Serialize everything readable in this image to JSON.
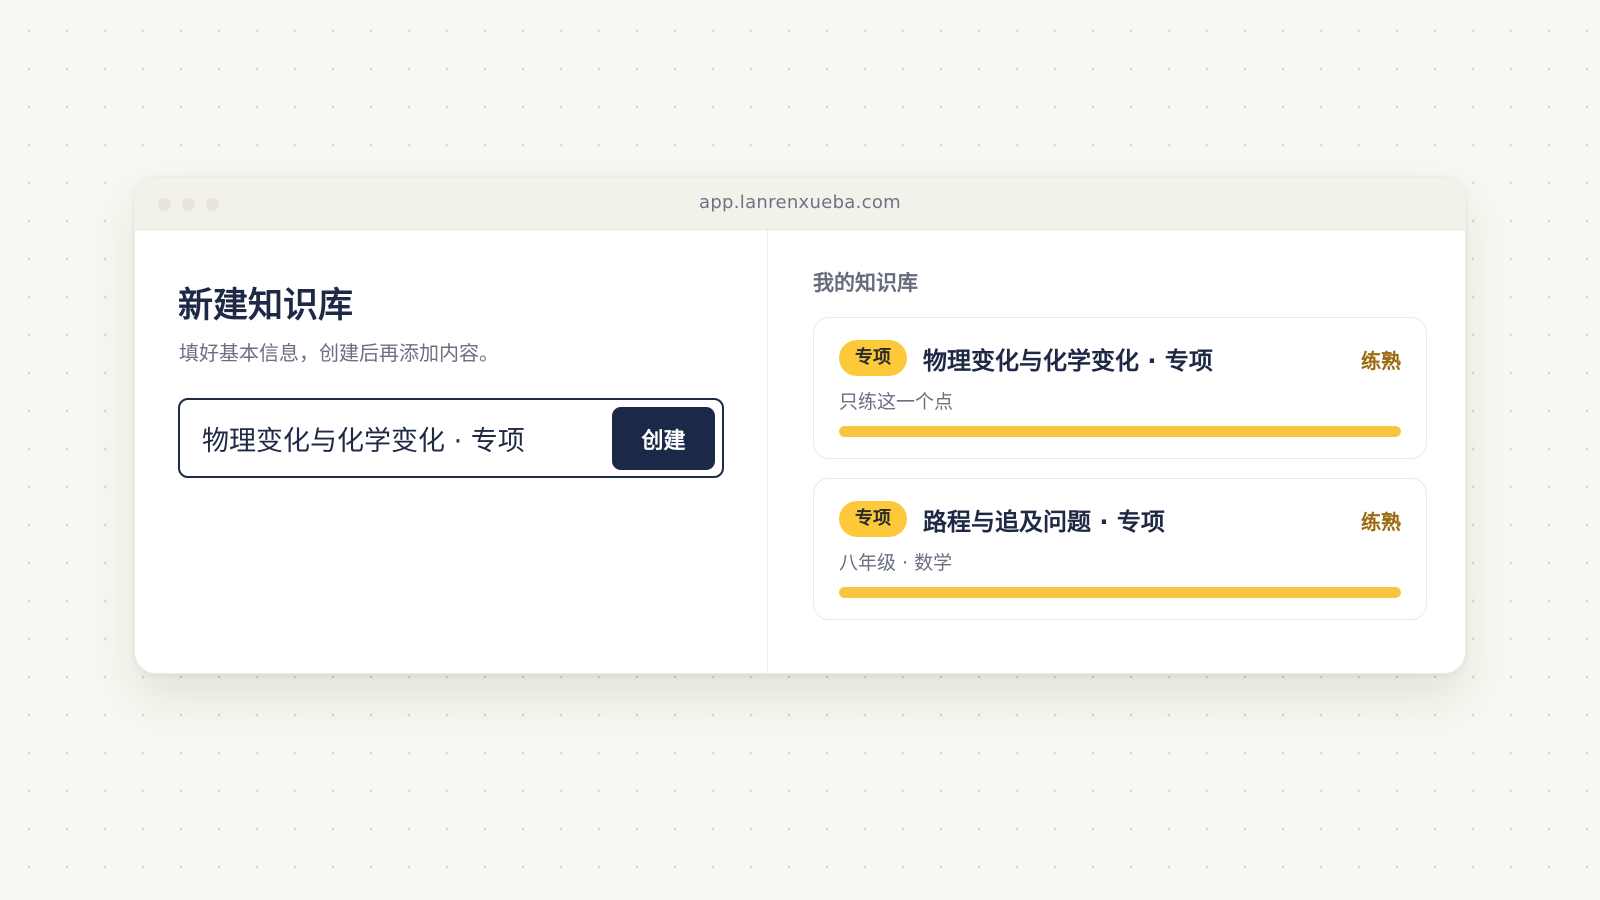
{
  "browser": {
    "url": "app.lanrenxueba.com"
  },
  "create": {
    "title": "新建知识库",
    "subtitle": "填好基本信息，创建后再添加内容。",
    "input_value": "物理变化与化学变化 · 专项",
    "button_label": "创建"
  },
  "library": {
    "heading": "我的知识库",
    "items": [
      {
        "tag": "专项",
        "title": "物理变化与化学变化 · 专项",
        "level": "练熟",
        "meta": "只练这一个点",
        "progress": 1.0
      },
      {
        "tag": "专项",
        "title": "路程与追及问题 · 专项",
        "level": "练熟",
        "meta": "八年级 · 数学",
        "progress": 1.0
      }
    ]
  },
  "colors": {
    "accent": "#fbc93a",
    "primary": "#1c2848",
    "level_text": "#9a6b12"
  }
}
